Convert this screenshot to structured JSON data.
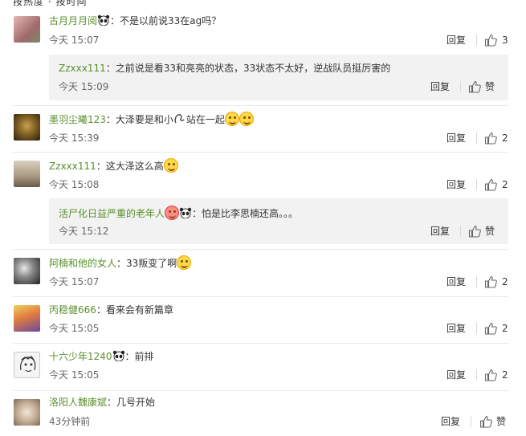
{
  "header": {
    "partial_text": "按热度 · 按时间"
  },
  "actions": {
    "reply": "回复",
    "like": "赞"
  },
  "comments": [
    {
      "user": "古月月月阅",
      "text": "：不是以前说33在ag吗？",
      "time": "今天 15:07",
      "likes": "3",
      "avatar_color": "#c98a8a"
    },
    {
      "user": "墨羽尘曦123",
      "text": "：大泽要是和小",
      "text_tail": "站在一起",
      "time": "今天 15:39",
      "likes": "2",
      "avatar_color": "#6b5a2c"
    },
    {
      "user": "Zzxxx111",
      "text": "：这大泽这么高",
      "time": "今天 15:08",
      "likes": "2",
      "avatar_color": "#9a8f7a"
    },
    {
      "user": "阿楠和他的女人",
      "text": "：33叛变了啊",
      "time": "今天 15:07",
      "likes": "2",
      "avatar_color": "#4a4a4a"
    },
    {
      "user": "丙稳健666",
      "text": "：看来会有新篇章",
      "time": "今天 15:05",
      "likes": "2",
      "avatar_color": "#d8a040"
    },
    {
      "user": "十六少年1240",
      "text": "：前排",
      "time": "今天 15:05",
      "likes": "2",
      "avatar_color": "#bbbbbb"
    },
    {
      "user": "洛阳人魏康斌",
      "text": "：几号开始",
      "time": "43分钟前",
      "likes": "",
      "avatar_color": "#b8a89a"
    }
  ],
  "replies": [
    {
      "user": "Zzxxx111",
      "text": "：之前说是看33和亮亮的状态，33状态不太好，逆战队员挺厉害的",
      "time": "今天 15:09"
    },
    {
      "user": "活尸化日益严重的老年人",
      "text": "：怕是比李思楠还高。。。",
      "time": "今天 15:12"
    }
  ]
}
